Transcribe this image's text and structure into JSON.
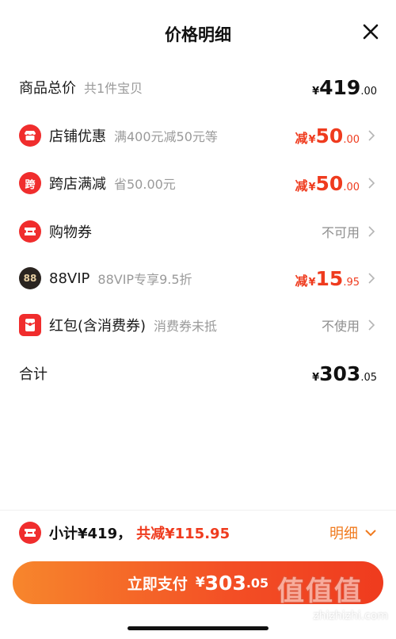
{
  "header": {
    "title": "价格明细"
  },
  "rows": {
    "goods": {
      "label": "商品总价",
      "sub": "共1件宝贝",
      "yen": "¥",
      "int": "419",
      "dec": ".00"
    },
    "shop": {
      "label": "店铺优惠",
      "sub": "满400元减50元等",
      "prefix": "减",
      "yen": "¥",
      "int": "50",
      "dec": ".00"
    },
    "cross": {
      "label": "跨店满减",
      "sub": "省50.00元",
      "icon_char": "跨",
      "prefix": "减",
      "yen": "¥",
      "int": "50",
      "dec": ".00"
    },
    "coupon": {
      "label": "购物券",
      "status": "不可用"
    },
    "vip": {
      "label": "88VIP",
      "sub": "88VIP专享9.5折",
      "icon_char": "88",
      "prefix": "减",
      "yen": "¥",
      "int": "15",
      "dec": ".95"
    },
    "redpacket": {
      "label": "红包(含消费券)",
      "sub": "消费券未抵",
      "status": "不使用"
    },
    "total": {
      "label": "合计",
      "yen": "¥",
      "int": "303",
      "dec": ".05"
    }
  },
  "summary": {
    "subtotal": "小计¥419，",
    "discount": "共减¥115.95",
    "detail": "明细"
  },
  "pay": {
    "label": "立即支付",
    "yen": "¥",
    "int": "303",
    "dec": ".05"
  },
  "watermark": {
    "chars": "值值值",
    "url": "zhizhizhi.com"
  },
  "colors": {
    "accent_red": "#ef3b1e",
    "detail_orange": "#f07a1e",
    "icon_red": "#f02d2d",
    "vip_dark": "#2a2420"
  }
}
